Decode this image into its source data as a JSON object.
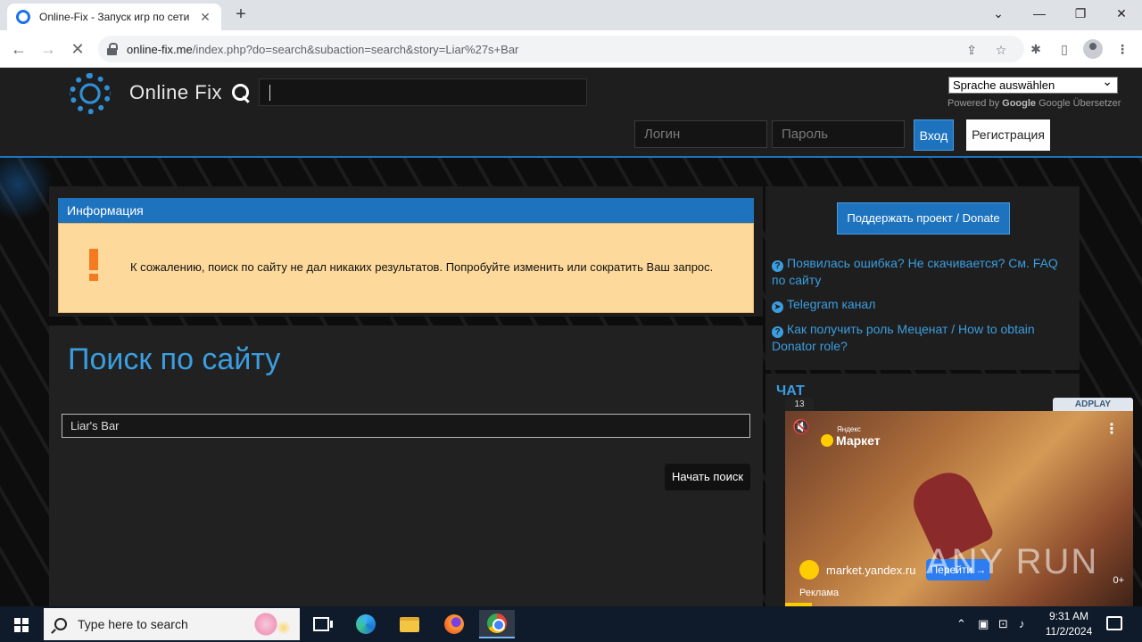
{
  "browser": {
    "tab_title": "Online-Fix - Запуск игр по сети",
    "tab_close": "✕",
    "new_tab": "+",
    "url_host": "online-fix.me",
    "url_path": "/index.php?do=search&subaction=search&story=Liar%27s+Bar",
    "window_controls": {
      "minimize": "—",
      "maximize": "❐",
      "close": "✕",
      "dropdown": "⌄"
    }
  },
  "site": {
    "logo_text": "Online Fix",
    "language_select": "Sprache auswählen",
    "powered_by": "Powered by",
    "google": "Google",
    "translator": "Google Übersetzer",
    "login_placeholder": "Логин",
    "password_placeholder": "Пароль",
    "login_button": "Вход",
    "register_button": "Регистрация"
  },
  "info": {
    "heading": "Информация",
    "message": "К сожалению, поиск по сайту не дал никаких результатов. Попробуйте изменить или сократить Ваш запрос."
  },
  "search": {
    "title": "Поиск по сайту",
    "query": "Liar's Bar",
    "button": "Начать поиск"
  },
  "sidebar": {
    "donate_button": "Поддержать проект / Donate",
    "links": [
      "Появилась ошибка? Не скачивается? См. FAQ по сайту",
      "Telegram канал",
      "Как получить роль Меценат / How to obtain Donator role?"
    ],
    "chat_title": "ЧАТ"
  },
  "ad": {
    "counter": "13",
    "brand_tag": "ADPLAY",
    "logo_small": "Яндекс",
    "logo_big": "Маркет",
    "domain": "market.yandex.ru",
    "go_button": "Перейти →",
    "age": "0+",
    "label": "Реклама"
  },
  "watermark": "ANY RUN",
  "taskbar": {
    "search_placeholder": "Type here to search",
    "time": "9:31 AM",
    "date": "11/2/2024"
  }
}
